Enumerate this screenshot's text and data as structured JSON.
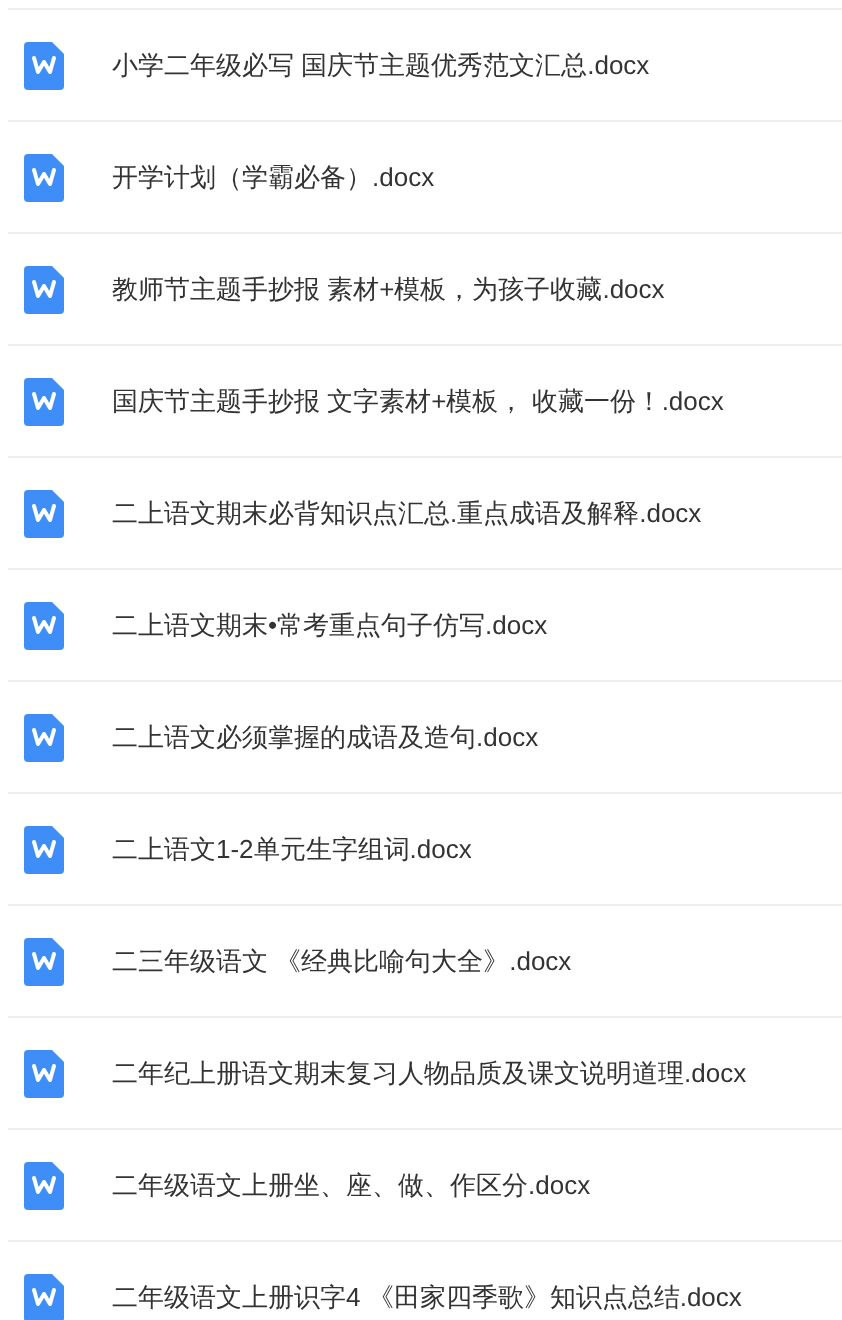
{
  "files": [
    {
      "name": "小学二年级必写 国庆节主题优秀范文汇总.docx"
    },
    {
      "name": "开学计划（学霸必备）.docx"
    },
    {
      "name": "教师节主题手抄报 素材+模板，为孩子收藏.docx"
    },
    {
      "name": "国庆节主题手抄报 文字素材+模板， 收藏一份！.docx"
    },
    {
      "name": "二上语文期末必背知识点汇总.重点成语及解释.docx"
    },
    {
      "name": "二上语文期末•常考重点句子仿写.docx"
    },
    {
      "name": "二上语文必须掌握的成语及造句.docx"
    },
    {
      "name": "二上语文1-2单元生字组词.docx"
    },
    {
      "name": "二三年级语文 《经典比喻句大全》.docx"
    },
    {
      "name": "二年纪上册语文期末复习人物品质及课文说明道理.docx"
    },
    {
      "name": "二年级语文上册坐、座、做、作区分.docx"
    },
    {
      "name": "二年级语文上册识字4 《田家四季歌》知识点总结.docx"
    }
  ]
}
